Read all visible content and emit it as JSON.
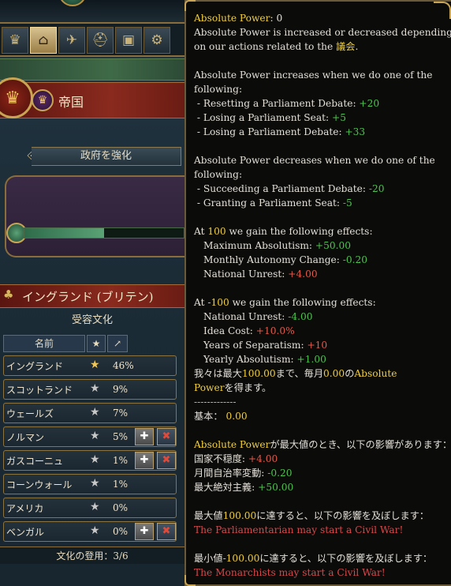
{
  "left_panel": {
    "tabs": [
      "crown-icon",
      "parliament-icon",
      "dove-icon",
      "helmet-icon",
      "crate-icon",
      "gears-icon",
      "ledger-icon"
    ],
    "active_tab": 1,
    "empire_label": "帝国",
    "strengthen_button": "政府を強化",
    "absolutism_fill": 0.5,
    "culture_name": "イングランド (ブリテン)",
    "accepted_culture_label": "受容文化",
    "table_headers": {
      "name": "名前"
    },
    "cultures": [
      {
        "name": "イングランド",
        "pct": "46%",
        "primary": true,
        "promote": false,
        "demote": false
      },
      {
        "name": "スコットランド",
        "pct": "9%",
        "primary": false,
        "promote": false,
        "demote": false
      },
      {
        "name": "ウェールズ",
        "pct": "7%",
        "primary": false,
        "promote": false,
        "demote": false
      },
      {
        "name": "ノルマン",
        "pct": "5%",
        "primary": false,
        "promote": true,
        "demote": true
      },
      {
        "name": "ガスコーニュ",
        "pct": "1%",
        "primary": false,
        "promote": true,
        "demote": true
      },
      {
        "name": "コーンウォール",
        "pct": "1%",
        "primary": false,
        "promote": false,
        "demote": false
      },
      {
        "name": "アメリカ",
        "pct": "0%",
        "primary": false,
        "promote": false,
        "demote": false
      },
      {
        "name": "ベンガル",
        "pct": "0%",
        "primary": false,
        "promote": true,
        "demote": true
      }
    ],
    "promoted_cultures": "文化の登用：3/6"
  },
  "tooltip": {
    "title": "Absolute Power",
    "title_value": "0",
    "intro_1": "Absolute Power is increased or decreased depending",
    "intro_2a": "on our actions related to the ",
    "intro_2b": "議会",
    "intro_2c": ".",
    "inc_header_1": "Absolute Power increases when we do one of the",
    "inc_header_2": "following:",
    "inc": [
      {
        "label": " - Resetting a Parliament Debate: ",
        "value": "+20"
      },
      {
        "label": " - Losing a Parliament Seat: ",
        "value": "+5"
      },
      {
        "label": " - Losing a Parliament Debate: ",
        "value": "+33"
      }
    ],
    "dec_header_1": "Absolute Power decreases when we do one of the",
    "dec_header_2": "following:",
    "dec": [
      {
        "label": " - Succeeding a Parliament Debate: ",
        "value": "-20"
      },
      {
        "label": " - Granting a Parliament Seat: ",
        "value": "-5"
      }
    ],
    "at_100": {
      "pre": "At ",
      "num": "100",
      "post": " we gain the following effects:"
    },
    "at_100_effects": [
      {
        "label": "Maximum Absolutism: ",
        "value": "+50.00",
        "color": "g"
      },
      {
        "label": "Monthly Autonomy Change: ",
        "value": "-0.20",
        "color": "g"
      },
      {
        "label": "National Unrest: ",
        "value": "+4.00",
        "color": "r"
      }
    ],
    "at_m100": {
      "pre": "At ",
      "num": "-100",
      "post": " we gain the following effects:"
    },
    "at_m100_effects": [
      {
        "label": "National Unrest: ",
        "value": "-4.00",
        "color": "g"
      },
      {
        "label": "Idea Cost: ",
        "value": "+10.0%",
        "color": "r"
      },
      {
        "label": "Years of Separatism: ",
        "value": "+10",
        "color": "r"
      },
      {
        "label": "Yearly Absolutism: ",
        "value": "+1.00",
        "color": "g"
      }
    ],
    "monthly_1a": "我々は最大",
    "monthly_1b": "100.00",
    "monthly_1c": "まで、毎月",
    "monthly_1d": "0.00",
    "monthly_1e": "の",
    "monthly_1f": "Absolute",
    "monthly_2a": "Power",
    "monthly_2b": "を得ます。",
    "separator": "-------------",
    "base_label": "基本： ",
    "base_value": "0.00",
    "max_1a": "Absolute Power",
    "max_1b": "が最大値のとき、以下の影響があります：",
    "max_effects": [
      {
        "label": "国家不穏度: ",
        "value": "+4.00",
        "color": "r"
      },
      {
        "label": "月間自治率変動: ",
        "value": "-0.20",
        "color": "g"
      },
      {
        "label": "最大絶対主義: ",
        "value": "+50.00",
        "color": "g"
      }
    ],
    "reach_max_a": "最大値",
    "reach_max_b": "100.00",
    "reach_max_c": "に達すると、以下の影響を及ぼします：",
    "reach_max_effect": "The Parliamentarian may start a Civil War!",
    "reach_min_a": "最小値",
    "reach_min_b": "-100.00",
    "reach_min_c": "に達すると、以下の影響を及ぼします：",
    "reach_min_effect": "The Monarchists may start a Civil War!"
  },
  "colors": {
    "highlight": "#f2cf3a",
    "positive": "#4ec34e",
    "negative": "#e25a4a",
    "tooltip_bg": "#0b0b0a"
  }
}
